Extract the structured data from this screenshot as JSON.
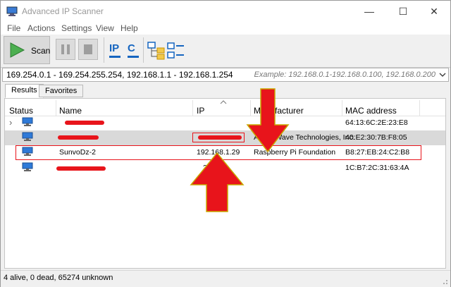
{
  "window": {
    "title": "Advanced IP Scanner",
    "min_glyph": "—",
    "max_glyph": "☐",
    "close_glyph": "✕"
  },
  "menu": [
    "File",
    "Actions",
    "Settings",
    "View",
    "Help"
  ],
  "toolbar": {
    "scan_label": "Scan",
    "ip_button_label": "IP",
    "c_button_label": "C"
  },
  "range": {
    "value": "169.254.0.1 - 169.254.255.254, 192.168.1.1 - 192.168.1.254",
    "example": "Example: 192.168.0.1-192.168.0.100, 192.168.0.200"
  },
  "tabs": [
    "Results",
    "Favorites"
  ],
  "columns": [
    "Status",
    "Name",
    "IP",
    "Manufacturer",
    "MAC address"
  ],
  "rows": [
    {
      "name": "",
      "ip": "",
      "manufacturer": "",
      "mac": "64:13:6C:2E:23:E8",
      "expand": "›"
    },
    {
      "name": "",
      "ip": "",
      "manufacturer": "Azure Wave Technologies, Inc.",
      "mac": "40:E2:30:7B:F8:05"
    },
    {
      "name": "SunvoDz-2",
      "ip": "192.168.1.29",
      "manufacturer": "Raspberry Pi Foundation",
      "mac": "B8:27:EB:24:C2:B8"
    },
    {
      "name": "",
      "ip": "2.1",
      "manufacturer": "",
      "mac": "1C:B7:2C:31:63:4A"
    }
  ],
  "status": "4 alive, 0 dead, 65274 unknown",
  "colors": {
    "annotation_red": "#e8141b",
    "selected_row": "#d9d9d9",
    "scan_green": "#4caf50"
  },
  "icons": [
    "app-icon",
    "scan-play-icon",
    "pause-icon",
    "stop-icon",
    "ip-icon",
    "c-icon",
    "network-tree-icon",
    "network-list-icon",
    "host-icon",
    "sort-up-icon",
    "dropdown-chevron-icon",
    "resize-grip-icon"
  ]
}
